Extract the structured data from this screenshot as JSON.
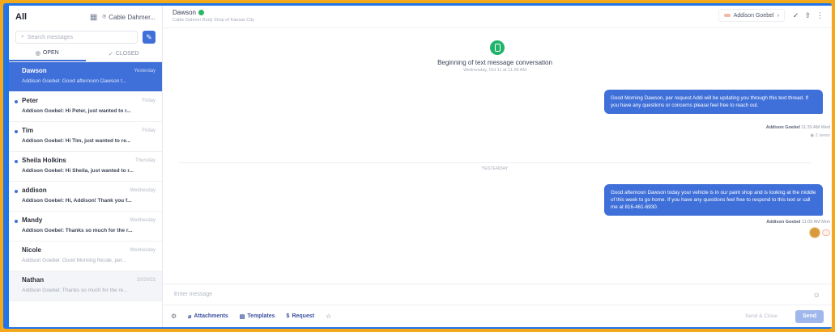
{
  "sidebar": {
    "title": "All",
    "location": "Cable Dahmer...",
    "search_placeholder": "Search messages",
    "tabs": [
      {
        "label": "OPEN",
        "active": true
      },
      {
        "label": "CLOSED",
        "active": false
      }
    ],
    "conversations": [
      {
        "name": "Dawson",
        "time": "Yesterday",
        "preview": "Addison Goebel: Good afternoon Dawson t...",
        "state": "active"
      },
      {
        "name": "Peter",
        "time": "Friday",
        "preview": "Addison Goebel: Hi Peter, just wanted to r...",
        "state": "unread"
      },
      {
        "name": "Tim",
        "time": "Friday",
        "preview": "Addison Goebel: Hi Tim, just wanted to re...",
        "state": "unread"
      },
      {
        "name": "Sheila Holkins",
        "time": "Thursday",
        "preview": "Addison Goebel: Hi Sheila, just wanted to r...",
        "state": "unread"
      },
      {
        "name": "addison",
        "time": "Wednesday",
        "preview": "Addison Goebel: Hi, Addison! Thank you f...",
        "state": "unread"
      },
      {
        "name": "Mandy",
        "time": "Wednesday",
        "preview": "Addison Goebel: Thanks so much for the r...",
        "state": "unread"
      },
      {
        "name": "Nicole",
        "time": "Wednesday",
        "preview": "Addison Goebel: Good Morning Nicole, per...",
        "state": "read"
      },
      {
        "name": "Nathan",
        "time": "10/20/23",
        "preview": "Addison Goebel: Thanks so much for the re...",
        "state": "hover"
      }
    ]
  },
  "header": {
    "contact_name": "Dawson",
    "contact_sub": "Cable Dahmer Body Shop of Kansas City",
    "assignee": "Addison Goebel",
    "colors": {
      "brand": "#3f6fd8",
      "verified": "#28b765",
      "frame": "#f4a81c"
    }
  },
  "thread": {
    "start_title": "Beginning of text message conversation",
    "start_date": "Wednesday, Oct 11 at 11:28 AM",
    "divider": "YESTERDAY",
    "messages": [
      {
        "text": "Good Morning Dawson, per request Addi will be updating you through this text thread. If you have any questions or concerns please feel free to reach out.",
        "author": "Addison Goebel",
        "time": "11:30 AM Wed",
        "receipt": "2 views"
      },
      {
        "text": "Good afternoon Dawson today your vehicle is in our paint shop and is looking at the middle of this week to go home. If you have any questions feel free to respond to this text or call me at 816-461-6930.",
        "author": "Addison Goebel",
        "time": "11:09 AM Mon"
      }
    ]
  },
  "composer": {
    "placeholder": "Enter message",
    "attachments": "Attachments",
    "templates": "Templates",
    "request": "Request",
    "send_close": "Send & Close",
    "send": "Send"
  }
}
